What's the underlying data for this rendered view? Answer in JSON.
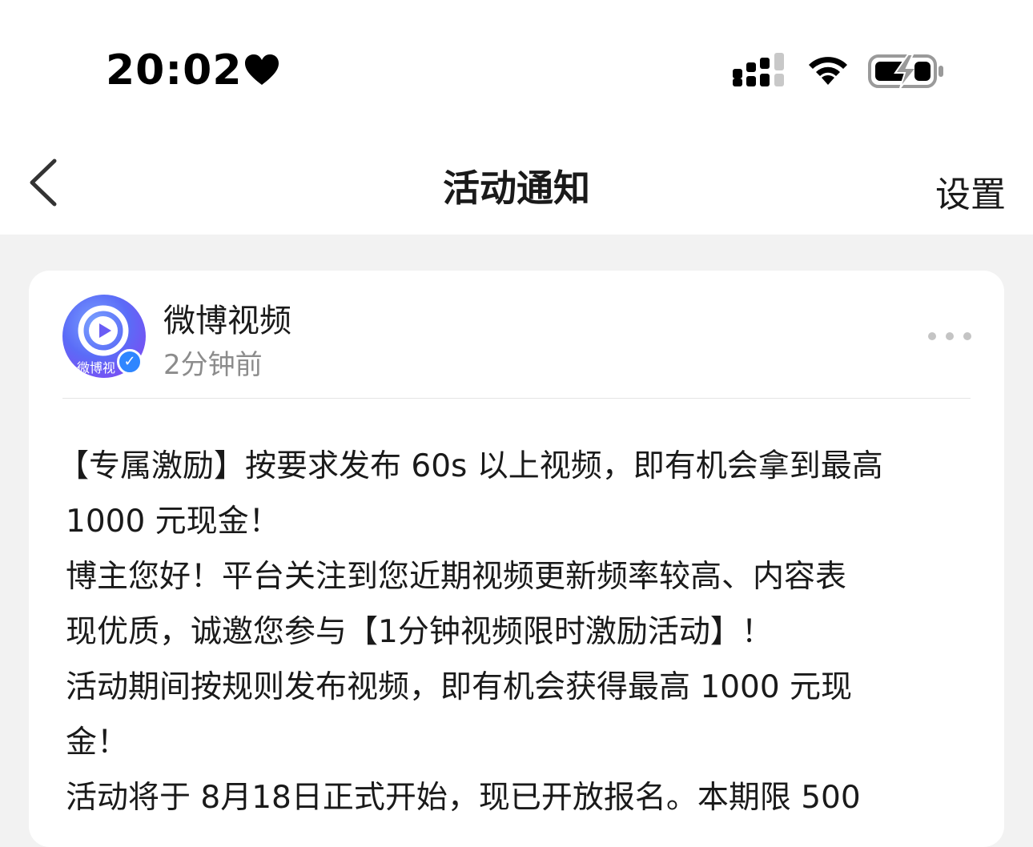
{
  "status_bar": {
    "time": "20:02"
  },
  "nav": {
    "title": "活动通知",
    "settings_label": "设置"
  },
  "message": {
    "author": "微博视频",
    "avatar_text": "微博视",
    "timestamp": "2分钟前",
    "paragraphs": [
      "【专属激励】按要求发布 60s 以上视频，即有机会拿到最高",
      "1000 元现金！",
      "博主您好！平台关注到您近期视频更新频率较高、内容表",
      "现优质，诚邀您参与【1分钟视频限时激励活动】！",
      "活动期间按规则发布视频，即有机会获得最高 1000 元现",
      "金！",
      "活动将于 8月18日正式开始，现已开放报名。本期限 500"
    ]
  },
  "colors": {
    "page_bg": "#f2f2f2",
    "card_bg": "#ffffff",
    "verify_badge": "#2f86ff",
    "secondary_text": "#8c8c8c"
  }
}
